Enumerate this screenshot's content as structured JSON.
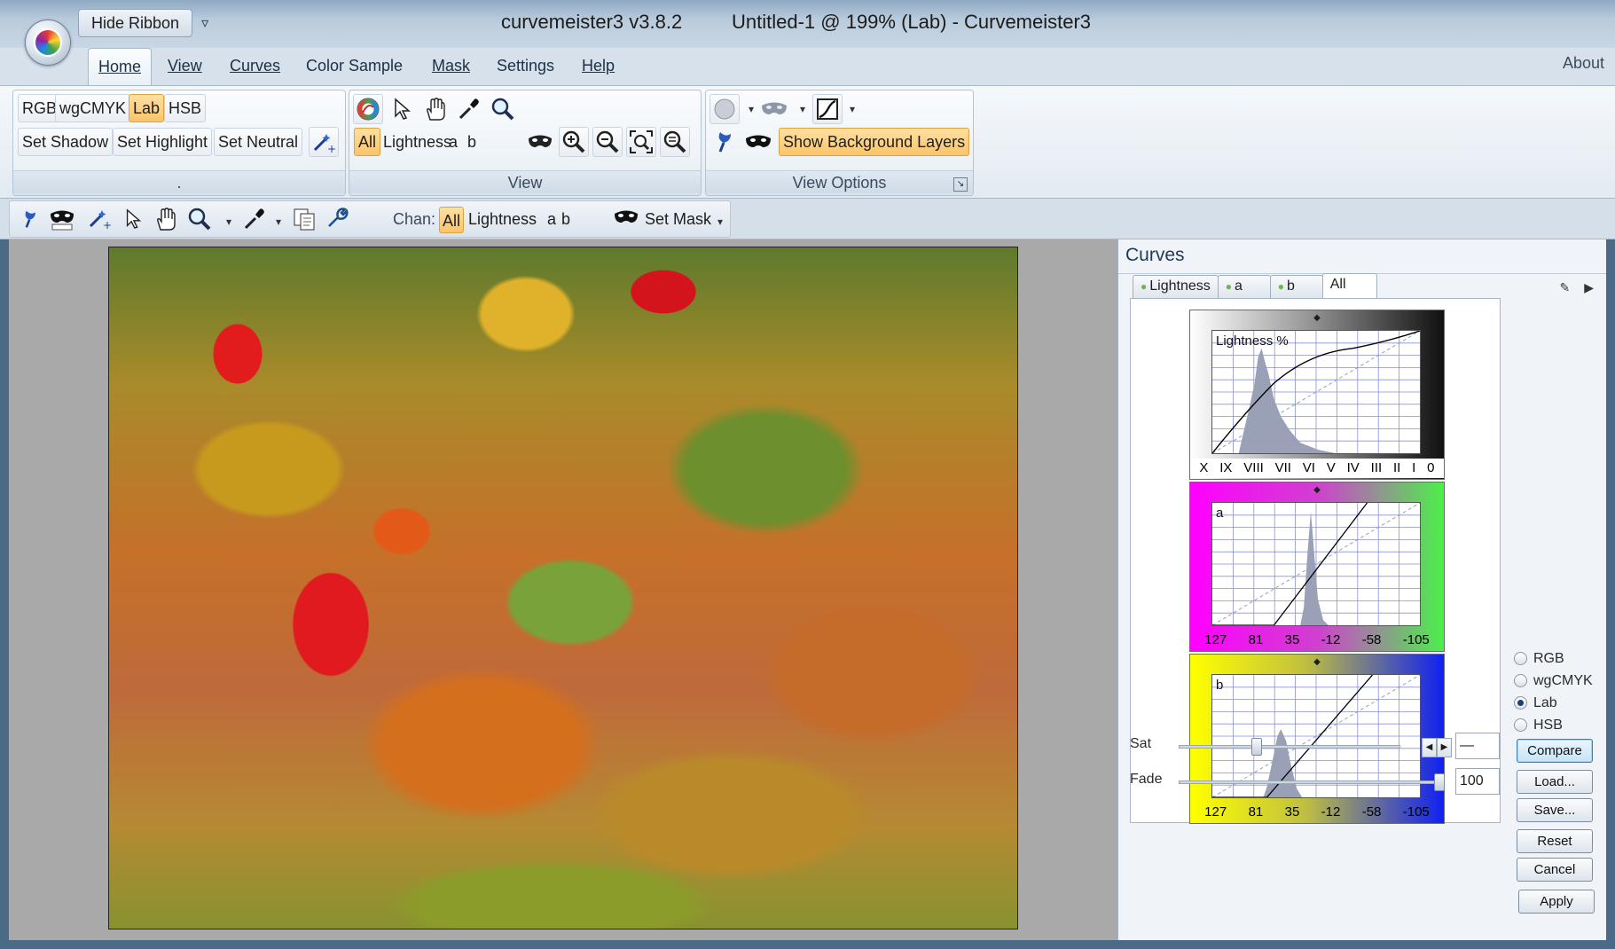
{
  "window": {
    "title": "Untitled-1 @ 199% (Lab) - Curvemeister3",
    "app_version": "curvemeister3 v3.8.2",
    "qat_button": "Hide Ribbon",
    "qat_dropdown_glyph": "▿"
  },
  "ribbon": {
    "tabs": [
      "Home",
      "View",
      "Curves",
      "Color Sample",
      "Mask",
      "Settings",
      "Help"
    ],
    "active_tab": "Home",
    "about": "About",
    "group1": {
      "colorspaces": [
        "RGB",
        "wgCMYK",
        "Lab",
        "HSB"
      ],
      "active_colorspace": "Lab",
      "set_shadow": "Set Shadow",
      "set_highlight": "Set Highlight",
      "set_neutral": "Set Neutral",
      "label": "."
    },
    "group2": {
      "channels": [
        "All",
        "Lightness",
        "a",
        "b"
      ],
      "active_channel": "All",
      "label": "View"
    },
    "group3": {
      "show_background_layers": "Show Background Layers",
      "label": "View Options"
    }
  },
  "toolbar": {
    "chan_label": "Chan:",
    "channels": [
      "All",
      "Lightness",
      "a",
      "b"
    ],
    "set_mask": "Set Mask"
  },
  "curves": {
    "title": "Curves",
    "tabs": [
      "Lightness",
      "a",
      "b",
      "All"
    ],
    "active_tab": "All",
    "lightness": {
      "label": "Lightness %",
      "ticks": [
        "X",
        "IX",
        "VIII",
        "VII",
        "VI",
        "V",
        "IV",
        "III",
        "II",
        "I",
        "0"
      ]
    },
    "a": {
      "label": "a",
      "ticks": [
        "127",
        "81",
        "35",
        "-12",
        "-58",
        "-105"
      ]
    },
    "b": {
      "label": "b",
      "ticks": [
        "127",
        "81",
        "35",
        "-12",
        "-58",
        "-105"
      ]
    },
    "sat_label": "Sat",
    "sat_value": "—",
    "fade_label": "Fade",
    "fade_value": "100",
    "colorspace_options": [
      "RGB",
      "wgCMYK",
      "Lab",
      "HSB"
    ],
    "selected_colorspace": "Lab",
    "buttons": {
      "compare": "Compare",
      "load": "Load...",
      "save": "Save...",
      "reset": "Reset",
      "cancel": "Cancel",
      "apply": "Apply"
    }
  },
  "colors": {
    "highlight": "#f9c46b",
    "accent": "#1e3a5a",
    "lightness_curve": "#000000",
    "histogram": "#9aa0b6"
  },
  "icons": [
    "color-wheel-icon",
    "pointer-icon",
    "hand-icon",
    "eyedropper-icon",
    "magnifier-icon",
    "zoom-in-icon",
    "zoom-out-icon",
    "zoom-fit-icon",
    "zoom-actual-icon",
    "mask-icon",
    "pin-icon",
    "copy-icon",
    "wrench-icon"
  ]
}
